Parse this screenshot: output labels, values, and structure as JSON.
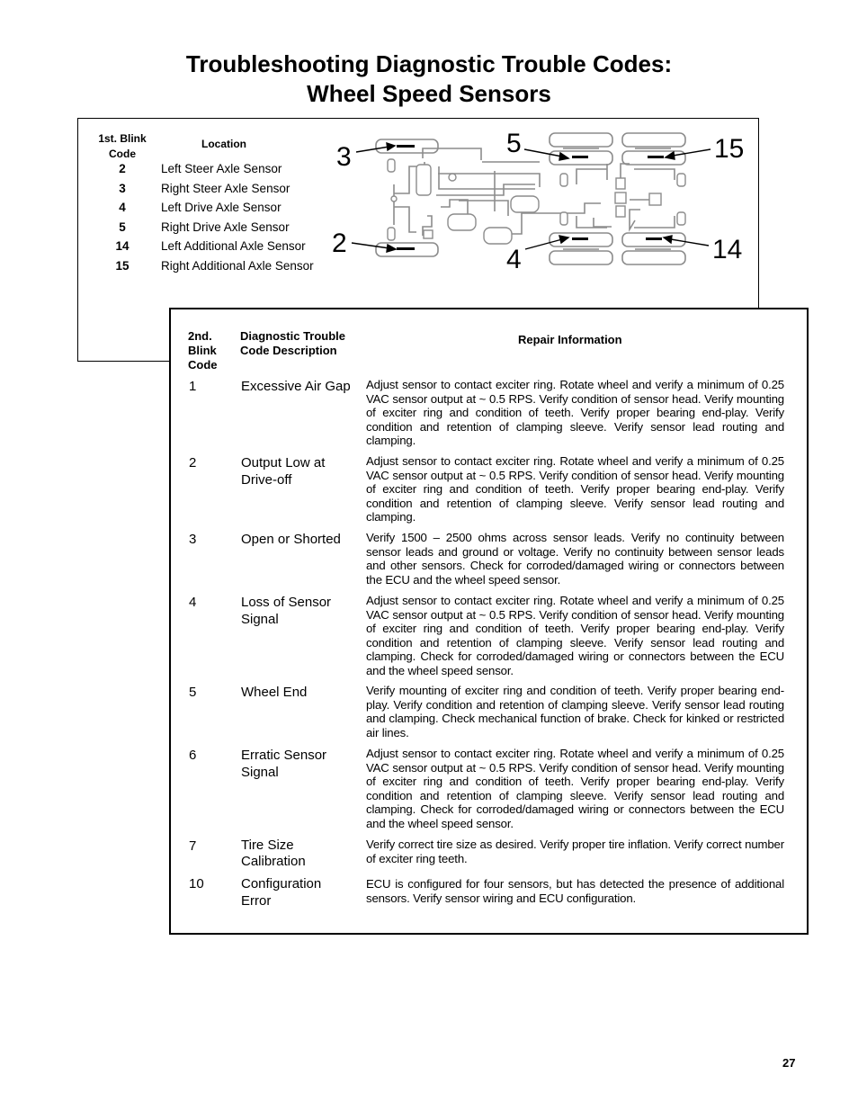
{
  "title": {
    "line1": "Troubleshooting Diagnostic Trouble Codes:",
    "line2": "Wheel Speed Sensors"
  },
  "location_table": {
    "header_code": "1st. Blink Code",
    "header_location": "Location",
    "rows": [
      {
        "code": "2",
        "location": "Left Steer Axle Sensor"
      },
      {
        "code": "3",
        "location": "Right Steer Axle Sensor"
      },
      {
        "code": "4",
        "location": "Left Drive Axle Sensor"
      },
      {
        "code": "5",
        "location": "Right Drive Axle Sensor"
      },
      {
        "code": "14",
        "location": "Left Additional Axle Sensor"
      },
      {
        "code": "15",
        "location": "Right Additional Axle Sensor"
      }
    ]
  },
  "diagram": {
    "labels": [
      "3",
      "2",
      "5",
      "4",
      "15",
      "14"
    ],
    "description": "Vehicle air brake system schematic with wheel speed sensor locations"
  },
  "dtc_table": {
    "header_code": "2nd. Blink Code",
    "header_description": "Diagnostic Trouble Code Description",
    "header_repair": "Repair Information",
    "rows": [
      {
        "code": "1",
        "description": "Excessive Air Gap",
        "repair": "Adjust sensor to contact exciter ring.  Rotate wheel and verify a minimum of 0.25 VAC sensor output at ~ 0.5 RPS.  Verify condition of sensor head. Verify mounting of exciter ring and condition of teeth.  Verify proper bearing end-play.  Verify condition and retention of clamping sleeve.  Verify sensor lead routing and clamping."
      },
      {
        "code": "2",
        "description": "Output Low at Drive-off",
        "repair": "Adjust sensor to contact exciter ring.  Rotate wheel and verify a minimum of 0.25 VAC sensor output at ~ 0.5 RPS.  Verify condition of sensor head. Verify mounting of exciter ring and condition of teeth.  Verify proper bearing end-play.  Verify condition and retention of clamping sleeve.  Verify sensor lead routing and clamping."
      },
      {
        "code": "3",
        "description": "Open or Shorted",
        "repair": "Verify 1500 – 2500 ohms across sensor leads.  Verify no continuity between sensor leads and ground or voltage.  Verify no continuity between sensor leads and other sensors.  Check for corroded/damaged wiring or connectors between the ECU and the wheel speed sensor."
      },
      {
        "code": "4",
        "description": "Loss of Sensor Signal",
        "repair": "Adjust sensor to contact exciter ring.  Rotate wheel and verify a minimum of 0.25 VAC sensor output at ~ 0.5 RPS.  Verify condition of sensor head. Verify mounting of exciter ring and condition of teeth.  Verify proper bearing end-play.  Verify condition and retention of clamping sleeve.  Verify sensor lead routing and clamping.  Check for corroded/damaged wiring or connectors between the ECU and the wheel speed sensor."
      },
      {
        "code": "5",
        "description": "Wheel End",
        "repair": "Verify mounting of exciter ring and condition of teeth.  Verify proper bearing end-play.  Verify condition and retention of clamping sleeve.  Verify sensor lead routing and clamping.  Check mechanical function of brake.  Check for kinked or restricted air lines."
      },
      {
        "code": "6",
        "description": "Erratic Sensor Signal",
        "repair": "Adjust sensor to contact exciter ring.  Rotate wheel and verify a minimum of 0.25 VAC sensor output at ~ 0.5 RPS.  Verify condition of sensor head. Verify mounting of exciter ring and condition of teeth.  Verify proper bearing end-play.  Verify condition and retention of clamping sleeve.  Verify sensor lead routing and clamping.  Check for corroded/damaged wiring or connectors between the ECU and the wheel speed sensor."
      },
      {
        "code": "7",
        "description": "Tire Size Calibration",
        "repair": "Verify correct tire size as desired.  Verify proper tire inflation.  Verify correct number of exciter ring teeth."
      },
      {
        "code": "10",
        "description": "Configuration Error",
        "repair": "ECU is configured for four sensors, but has detected the presence of additional sensors.  Verify sensor wiring and ECU configuration."
      }
    ]
  },
  "page_number": "27"
}
